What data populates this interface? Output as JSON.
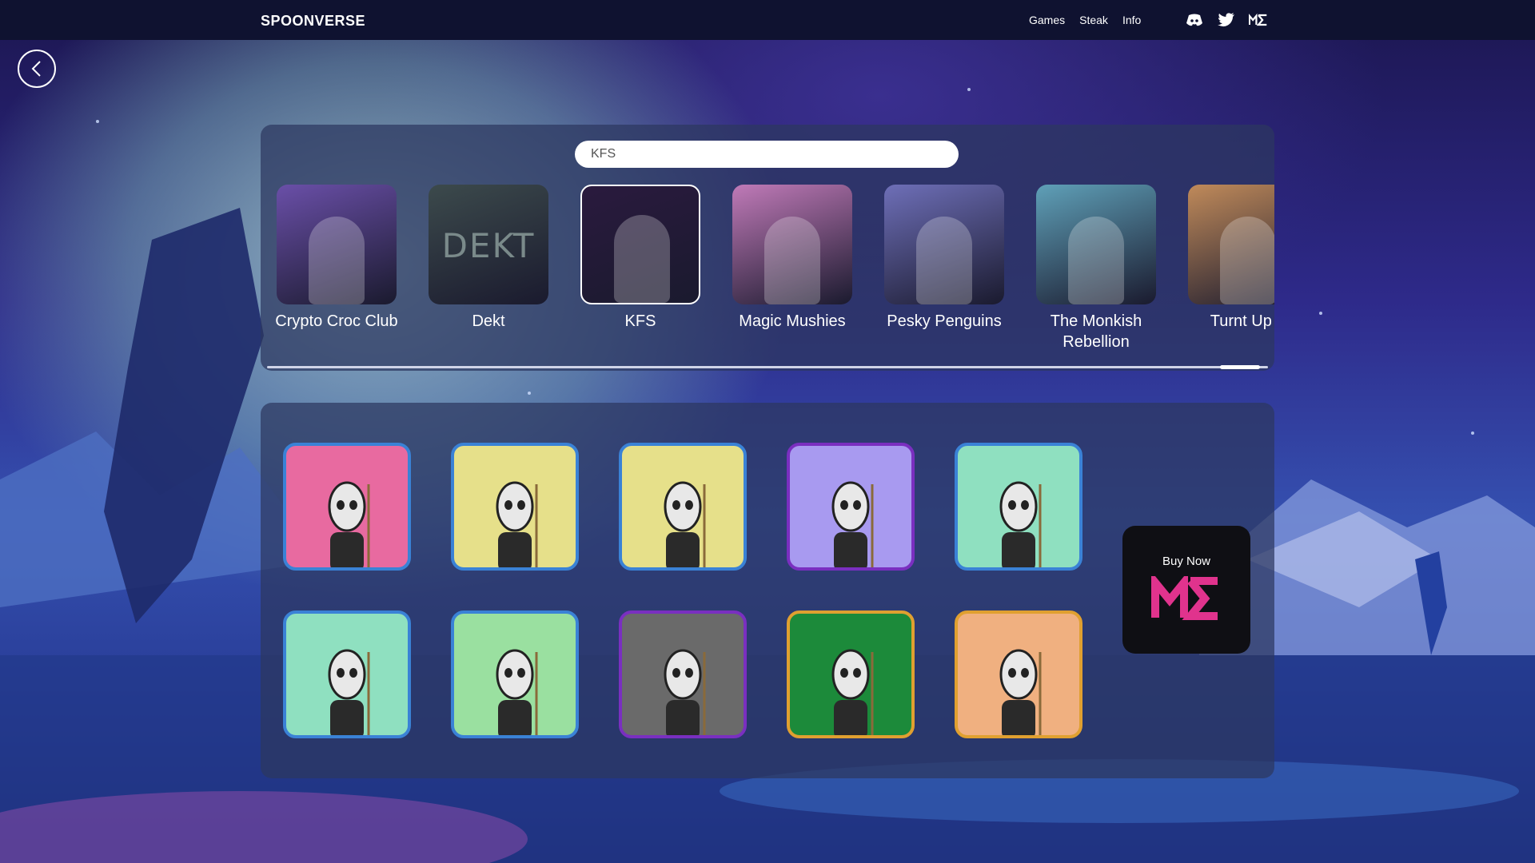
{
  "header": {
    "brand": "SPOONVERSE",
    "nav": [
      "Games",
      "Steak",
      "Info"
    ],
    "social_icons": [
      "discord-icon",
      "twitter-icon",
      "magic-eden-icon"
    ]
  },
  "back_icon": "chevron-left-icon",
  "search": {
    "value": "KFS",
    "placeholder": ""
  },
  "collections": [
    {
      "name": "Crypto Croc Club",
      "color": "#6a4fa8",
      "selected": false
    },
    {
      "name": "Dekt",
      "color": "#3c4a4c",
      "thumb_text": "DEKT",
      "selected": false
    },
    {
      "name": "KFS",
      "color": "#2a1a3e",
      "selected": true
    },
    {
      "name": "Magic Mushies",
      "color": "#c07ab8",
      "selected": false
    },
    {
      "name": "Pesky Penguins",
      "color": "#6e6fb8",
      "selected": false
    },
    {
      "name": "The Monkish Rebellion",
      "color": "#5fa0b8",
      "selected": false
    },
    {
      "name": "Turnt Up T",
      "color": "#c08a5a",
      "selected": false
    }
  ],
  "nfts": [
    {
      "bg": "#e86aa0",
      "border": "#3a82d6"
    },
    {
      "bg": "#e6e08a",
      "border": "#3a82d6"
    },
    {
      "bg": "#e6e08a",
      "border": "#3a82d6"
    },
    {
      "bg": "#a89af0",
      "border": "#7a2fc0"
    },
    {
      "bg": "#8fe0c0",
      "border": "#3a82d6"
    },
    {
      "bg": "#8fe0c0",
      "border": "#3a82d6"
    },
    {
      "bg": "#9ae0a0",
      "border": "#3a82d6"
    },
    {
      "bg": "#6a6a6a",
      "border": "#7a2fc0"
    },
    {
      "bg": "#1c8a3a",
      "border": "#e0a030"
    },
    {
      "bg": "#f0b080",
      "border": "#e0a030"
    }
  ],
  "buy_now": {
    "label": "Buy Now",
    "icon": "magic-eden-icon",
    "icon_color": "#e0338d"
  }
}
